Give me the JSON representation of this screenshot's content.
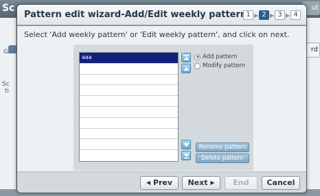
{
  "background": {
    "title_fragment": "Sc",
    "right_button_fragment": "ut",
    "right_tab_fragment": "rd",
    "left_labels": [
      "G",
      "Sc",
      "ti"
    ]
  },
  "dialog": {
    "title": "Pattern edit wizard-Add/Edit weekly pattern",
    "steps": [
      {
        "label": "1",
        "active": false
      },
      {
        "label": "2",
        "active": true
      },
      {
        "label": "3",
        "active": false
      },
      {
        "label": "4",
        "active": false
      }
    ],
    "instruction": "Select 'Add weekly pattern' or 'Edit weekly pattern', and click on next.",
    "patterns": [
      "aaa",
      "",
      "",
      "",
      "",
      "",
      "",
      "",
      "",
      ""
    ],
    "selected_pattern": "aaa",
    "options": {
      "add_label": "Add pattern",
      "modify_label": "Modify pattern",
      "selected": "add"
    },
    "rename_button": "Rename pattern",
    "delete_button": "Delete pattern",
    "footer": {
      "prev": "Prev",
      "next": "Next",
      "end": "End",
      "cancel": "Cancel"
    },
    "accent_color": "#2d5d8a",
    "selection_color": "#12207a"
  }
}
